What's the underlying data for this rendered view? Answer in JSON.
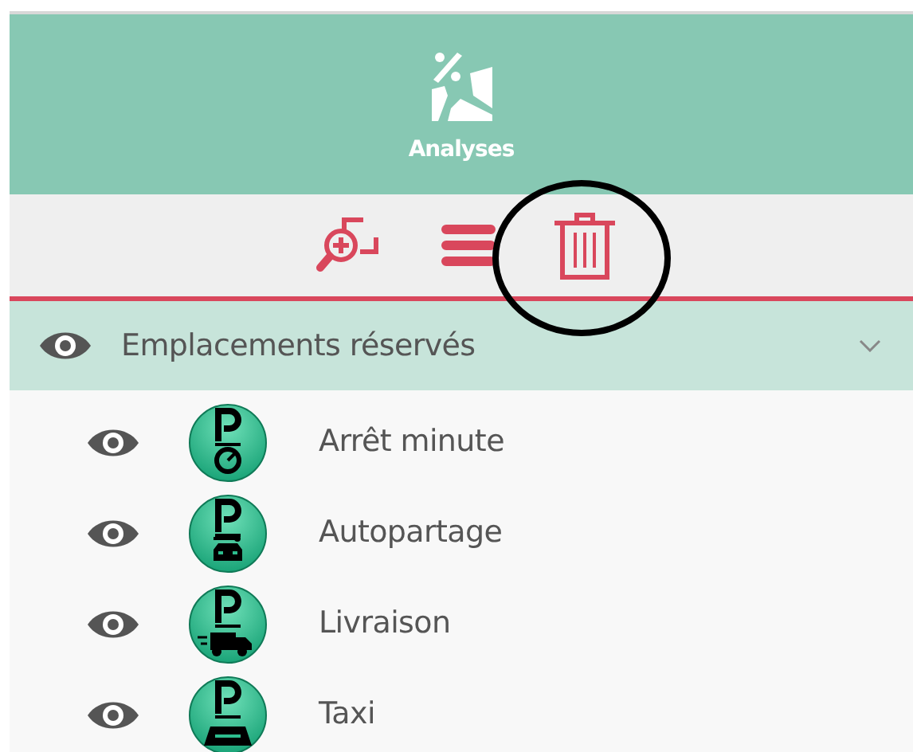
{
  "header": {
    "title": "Analyses"
  },
  "toolbar": {
    "buttons": [
      {
        "kind": "zoom"
      },
      {
        "kind": "menu"
      },
      {
        "kind": "delete",
        "highlighted": true
      }
    ]
  },
  "group": {
    "label": "Emplacements réservés",
    "visible": true,
    "expanded": true,
    "items": [
      {
        "label": "Arrêt minute",
        "kind": "timer",
        "visible": true
      },
      {
        "label": "Autopartage",
        "kind": "carshare",
        "visible": true
      },
      {
        "label": "Livraison",
        "kind": "delivery",
        "visible": true
      },
      {
        "label": "Taxi",
        "kind": "taxi",
        "visible": true
      }
    ]
  }
}
